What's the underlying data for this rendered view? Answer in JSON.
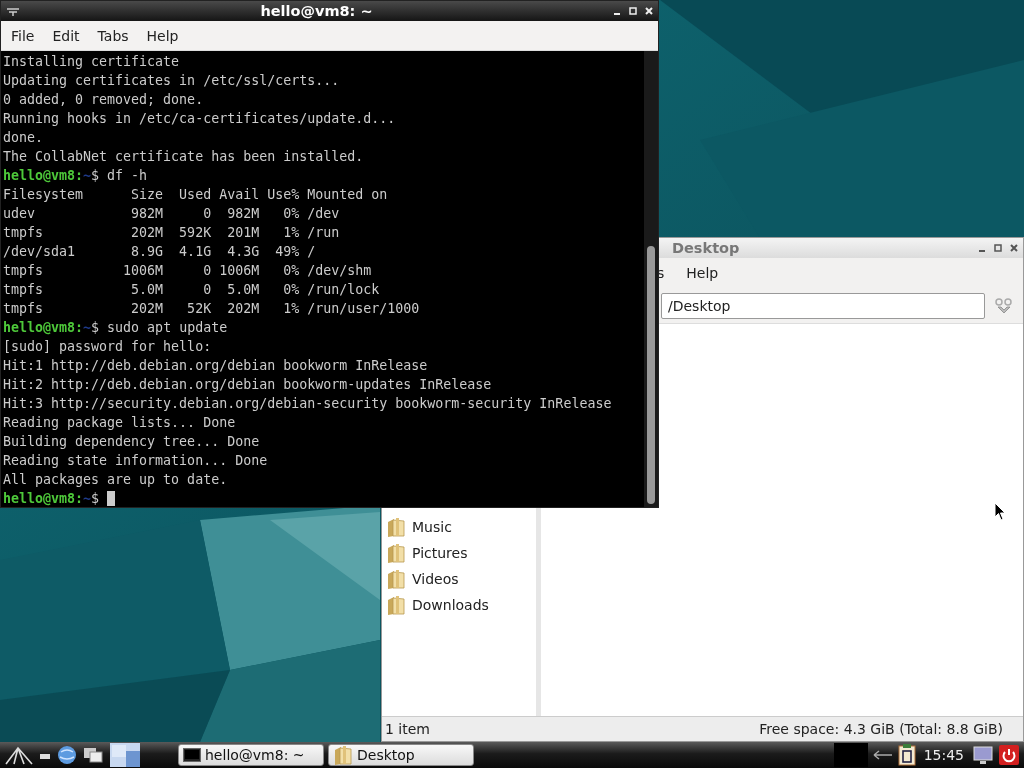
{
  "terminal": {
    "title": "hello@vm8: ~",
    "active": true,
    "menu": [
      "File",
      "Edit",
      "Tabs",
      "Help"
    ],
    "lines": [
      {
        "kind": "output",
        "text": "Installing certificate"
      },
      {
        "kind": "output",
        "text": "Updating certificates in /etc/ssl/certs..."
      },
      {
        "kind": "output",
        "text": "0 added, 0 removed; done."
      },
      {
        "kind": "output",
        "text": "Running hooks in /etc/ca-certificates/update.d..."
      },
      {
        "kind": "output",
        "text": "done."
      },
      {
        "kind": "output",
        "text": "The CollabNet certificate has been installed."
      },
      {
        "kind": "prompt",
        "prompt": "hello@vm8:",
        "path": "~",
        "text": "$ df -h"
      },
      {
        "kind": "output",
        "text": "Filesystem      Size  Used Avail Use% Mounted on"
      },
      {
        "kind": "output",
        "text": "udev            982M     0  982M   0% /dev"
      },
      {
        "kind": "output",
        "text": "tmpfs           202M  592K  201M   1% /run"
      },
      {
        "kind": "output",
        "text": "/dev/sda1       8.9G  4.1G  4.3G  49% /"
      },
      {
        "kind": "output",
        "text": "tmpfs          1006M     0 1006M   0% /dev/shm"
      },
      {
        "kind": "output",
        "text": "tmpfs           5.0M     0  5.0M   0% /run/lock"
      },
      {
        "kind": "output",
        "text": "tmpfs           202M   52K  202M   1% /run/user/1000"
      },
      {
        "kind": "prompt",
        "prompt": "hello@vm8:",
        "path": "~",
        "text": "$ sudo apt update"
      },
      {
        "kind": "output",
        "text": "[sudo] password for hello:"
      },
      {
        "kind": "output",
        "text": "Hit:1 http://deb.debian.org/debian bookworm InRelease"
      },
      {
        "kind": "output",
        "text": "Hit:2 http://deb.debian.org/debian bookworm-updates InRelease"
      },
      {
        "kind": "output",
        "text": "Hit:3 http://security.debian.org/debian-security bookworm-security InRelease"
      },
      {
        "kind": "output",
        "text": "Reading package lists... Done"
      },
      {
        "kind": "output",
        "text": "Building dependency tree... Done"
      },
      {
        "kind": "output",
        "text": "Reading state information... Done"
      },
      {
        "kind": "output",
        "text": "All packages are up to date."
      },
      {
        "kind": "prompt",
        "prompt": "hello@vm8:",
        "path": "~",
        "text": "$",
        "cursor": true
      }
    ]
  },
  "file_manager": {
    "title": "Desktop",
    "active": false,
    "menu": [
      "s",
      "Help"
    ],
    "path": "/Desktop",
    "places": [
      "Music",
      "Pictures",
      "Videos",
      "Downloads"
    ],
    "status_left": "1 item",
    "status_right": "Free space: 4.3 GiB (Total: 8.8 GiB)"
  },
  "taskbar": {
    "tasks": [
      {
        "kind": "terminal",
        "label": "hello@vm8: ~"
      },
      {
        "kind": "folder",
        "label": "Desktop"
      }
    ],
    "clock": "15:45"
  }
}
